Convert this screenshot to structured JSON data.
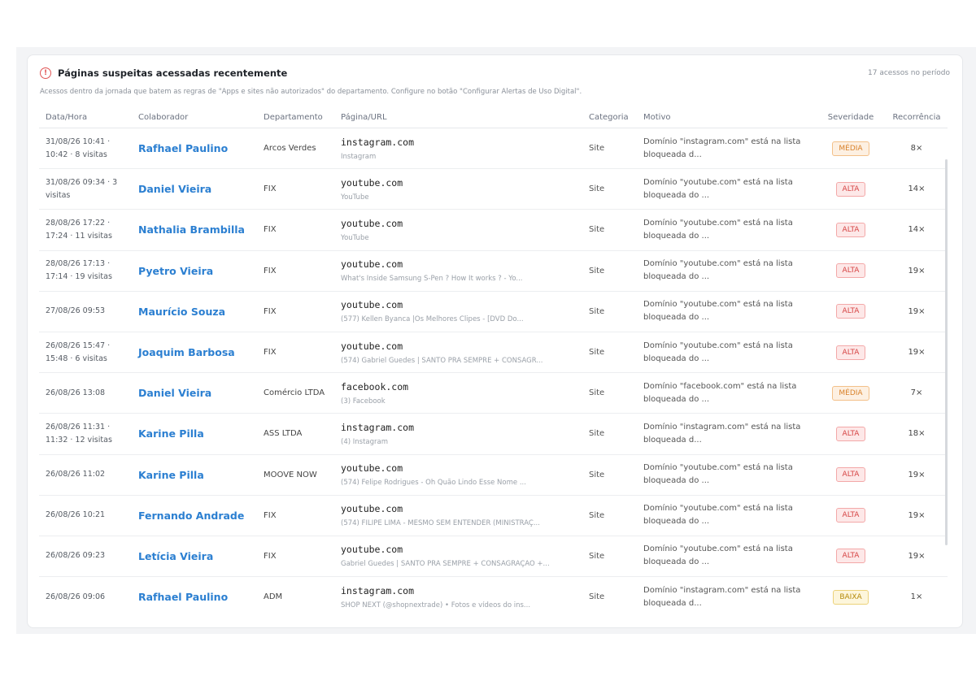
{
  "card": {
    "title": "Páginas suspeitas acessadas recentemente",
    "subtitle": "Acessos dentro da jornada que batem as regras de \"Apps e sites não autorizados\" do departamento. Configure no botão \"Configurar Alertas de Uso Digital\".",
    "count": "17 acessos no período",
    "icon": "alert-circle-icon"
  },
  "columns": {
    "datetime": "Data/Hora",
    "employee": "Colaborador",
    "department": "Departamento",
    "page": "Página/URL",
    "category": "Categoria",
    "reason": "Motivo",
    "severity": "Severidade",
    "recurrence": "Recorrência"
  },
  "rows": [
    {
      "datetime": "31/08/26 10:41 · 10:42 · 8 visitas",
      "employee": "Rafhael Paulino",
      "department": "Arcos Verdes",
      "url": "instagram.com",
      "page_title": "Instagram",
      "category": "Site",
      "reason": "Domínio \"instagram.com\" está na lista bloqueada d...",
      "severity": "MÉDIA",
      "level": "media",
      "recurrence": "8×"
    },
    {
      "datetime": "31/08/26 09:34 · 3 visitas",
      "employee": "Daniel Vieira",
      "department": "FIX",
      "url": "youtube.com",
      "page_title": "YouTube",
      "category": "Site",
      "reason": "Domínio \"youtube.com\" está na lista bloqueada do ...",
      "severity": "ALTA",
      "level": "alta",
      "recurrence": "14×"
    },
    {
      "datetime": "28/08/26 17:22 · 17:24 · 11 visitas",
      "employee": "Nathalia Brambilla",
      "department": "FIX",
      "url": "youtube.com",
      "page_title": "YouTube",
      "category": "Site",
      "reason": "Domínio \"youtube.com\" está na lista bloqueada do ...",
      "severity": "ALTA",
      "level": "alta",
      "recurrence": "14×"
    },
    {
      "datetime": "28/08/26 17:13 · 17:14 · 19 visitas",
      "employee": "Pyetro Vieira",
      "department": "FIX",
      "url": "youtube.com",
      "page_title": "What's Inside Samsung S-Pen ? How It works ? - Yo...",
      "category": "Site",
      "reason": "Domínio \"youtube.com\" está na lista bloqueada do ...",
      "severity": "ALTA",
      "level": "alta",
      "recurrence": "19×"
    },
    {
      "datetime": "27/08/26 09:53",
      "employee": "Maurício Souza",
      "department": "FIX",
      "url": "youtube.com",
      "page_title": "(577) Kellen Byanca |Os Melhores Clipes - [DVD Do...",
      "category": "Site",
      "reason": "Domínio \"youtube.com\" está na lista bloqueada do ...",
      "severity": "ALTA",
      "level": "alta",
      "recurrence": "19×"
    },
    {
      "datetime": "26/08/26 15:47 · 15:48 · 6 visitas",
      "employee": "Joaquim Barbosa",
      "department": "FIX",
      "url": "youtube.com",
      "page_title": "(574) Gabriel Guedes | SANTO PRA SEMPRE + CONSAGR...",
      "category": "Site",
      "reason": "Domínio \"youtube.com\" está na lista bloqueada do ...",
      "severity": "ALTA",
      "level": "alta",
      "recurrence": "19×"
    },
    {
      "datetime": "26/08/26 13:08",
      "employee": "Daniel Vieira",
      "department": "Comércio LTDA",
      "url": "facebook.com",
      "page_title": "(3) Facebook",
      "category": "Site",
      "reason": "Domínio \"facebook.com\" está na lista bloqueada do ...",
      "severity": "MÉDIA",
      "level": "media",
      "recurrence": "7×"
    },
    {
      "datetime": "26/08/26 11:31 · 11:32 · 12 visitas",
      "employee": "Karine Pilla",
      "department": "ASS LTDA",
      "url": "instagram.com",
      "page_title": "(4) Instagram",
      "category": "Site",
      "reason": "Domínio \"instagram.com\" está na lista bloqueada d...",
      "severity": "ALTA",
      "level": "alta",
      "recurrence": "18×"
    },
    {
      "datetime": "26/08/26 11:02",
      "employee": "Karine Pilla",
      "department": "MOOVE NOW",
      "url": "youtube.com",
      "page_title": "(574) Felipe Rodrigues - Oh Quão Lindo Esse Nome ...",
      "category": "Site",
      "reason": "Domínio \"youtube.com\" está na lista bloqueada do ...",
      "severity": "ALTA",
      "level": "alta",
      "recurrence": "19×"
    },
    {
      "datetime": "26/08/26 10:21",
      "employee": "Fernando Andrade",
      "department": "FIX",
      "url": "youtube.com",
      "page_title": "(574) FILIPE LIMA - MESMO SEM ENTENDER (MINISTRAÇ...",
      "category": "Site",
      "reason": "Domínio \"youtube.com\" está na lista bloqueada do ...",
      "severity": "ALTA",
      "level": "alta",
      "recurrence": "19×"
    },
    {
      "datetime": "26/08/26 09:23",
      "employee": "Letícia Vieira",
      "department": "FIX",
      "url": "youtube.com",
      "page_title": "Gabriel Guedes | SANTO PRA SEMPRE + CONSAGRAÇÃO +...",
      "category": "Site",
      "reason": "Domínio \"youtube.com\" está na lista bloqueada do ...",
      "severity": "ALTA",
      "level": "alta",
      "recurrence": "19×"
    },
    {
      "datetime": "26/08/26 09:06",
      "employee": "Rafhael Paulino",
      "department": "ADM",
      "url": "instagram.com",
      "page_title": "SHOP NEXT (@shopnextrade) • Fotos e vídeos do ins...",
      "category": "Site",
      "reason": "Domínio \"instagram.com\" está na lista bloqueada d...",
      "severity": "BAIXA",
      "level": "baixa",
      "recurrence": "1×"
    }
  ]
}
